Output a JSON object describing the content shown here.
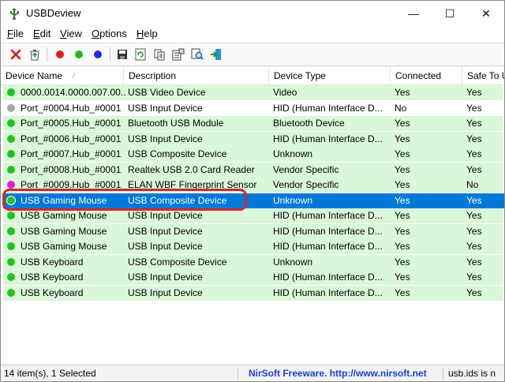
{
  "window": {
    "title": "USBDeview",
    "controls": {
      "minimize": "—",
      "maximize": "☐",
      "close": "✕"
    }
  },
  "menu": {
    "items": [
      {
        "first": "F",
        "rest": "ile"
      },
      {
        "first": "E",
        "rest": "dit"
      },
      {
        "first": "V",
        "rest": "iew"
      },
      {
        "first": "O",
        "rest": "ptions"
      },
      {
        "first": "H",
        "rest": "elp"
      }
    ]
  },
  "toolbar": {
    "icons": [
      "uninstall-icon",
      "recycle-icon",
      "red-dot-icon",
      "green-dot-icon",
      "blue-dot-icon",
      "save-icon",
      "refresh-icon",
      "copy-icon",
      "properties-icon",
      "find-icon",
      "exit-icon"
    ],
    "colors": {
      "red": "#e01c1c",
      "green": "#1bb81b",
      "blue": "#1c2fd6"
    }
  },
  "list": {
    "columns": [
      "Device Name",
      "Description",
      "Device Type",
      "Connected",
      "Safe To U"
    ],
    "sort_glyph": "⁄",
    "rows": [
      {
        "name": "0000.0014.0000.007.00...",
        "description": "USB Video Device",
        "type": "Video",
        "connected": "Yes",
        "safe": "Yes",
        "status": "green",
        "bg": "green"
      },
      {
        "name": "Port_#0004.Hub_#0001",
        "description": "USB Input Device",
        "type": "HID (Human Interface D...",
        "connected": "No",
        "safe": "Yes",
        "status": "gray",
        "bg": "white"
      },
      {
        "name": "Port_#0005.Hub_#0001",
        "description": "Bluetooth USB Module",
        "type": "Bluetooth Device",
        "connected": "Yes",
        "safe": "Yes",
        "status": "green",
        "bg": "green"
      },
      {
        "name": "Port_#0006.Hub_#0001",
        "description": "USB Input Device",
        "type": "HID (Human Interface D...",
        "connected": "Yes",
        "safe": "Yes",
        "status": "green",
        "bg": "green"
      },
      {
        "name": "Port_#0007.Hub_#0001",
        "description": "USB Composite Device",
        "type": "Unknown",
        "connected": "Yes",
        "safe": "Yes",
        "status": "green",
        "bg": "green"
      },
      {
        "name": "Port_#0008.Hub_#0001",
        "description": "Realtek USB 2.0 Card Reader",
        "type": "Vendor Specific",
        "connected": "Yes",
        "safe": "Yes",
        "status": "green",
        "bg": "green"
      },
      {
        "name": "Port_#0009.Hub_#0001",
        "description": "ELAN WBF Fingerprint Sensor",
        "type": "Vendor Specific",
        "connected": "Yes",
        "safe": "No",
        "status": "magenta",
        "bg": "green"
      },
      {
        "name": "USB Gaming Mouse",
        "description": "USB Composite Device",
        "type": "Unknown",
        "connected": "Yes",
        "safe": "Yes",
        "status": "green",
        "bg": "selected"
      },
      {
        "name": "USB Gaming Mouse",
        "description": "USB Input Device",
        "type": "HID (Human Interface D...",
        "connected": "Yes",
        "safe": "Yes",
        "status": "green",
        "bg": "green"
      },
      {
        "name": "USB Gaming Mouse",
        "description": "USB Input Device",
        "type": "HID (Human Interface D...",
        "connected": "Yes",
        "safe": "Yes",
        "status": "green",
        "bg": "green"
      },
      {
        "name": "USB Gaming Mouse",
        "description": "USB Input Device",
        "type": "HID (Human Interface D...",
        "connected": "Yes",
        "safe": "Yes",
        "status": "green",
        "bg": "green"
      },
      {
        "name": "USB Keyboard",
        "description": "USB Composite Device",
        "type": "Unknown",
        "connected": "Yes",
        "safe": "Yes",
        "status": "green",
        "bg": "green"
      },
      {
        "name": "USB Keyboard",
        "description": "USB Input Device",
        "type": "HID (Human Interface D...",
        "connected": "Yes",
        "safe": "Yes",
        "status": "green",
        "bg": "green"
      },
      {
        "name": "USB Keyboard",
        "description": "USB Input Device",
        "type": "HID (Human Interface D...",
        "connected": "Yes",
        "safe": "Yes",
        "status": "green",
        "bg": "green"
      }
    ],
    "colors": {
      "row_green": "#d9f7d9",
      "row_white": "#ffffff",
      "row_selected": "#0078d7",
      "dot_green": "#1fc41f",
      "dot_gray": "#a8a8a8",
      "dot_magenta": "#e01ce0",
      "highlight_ring": "#d6262e"
    }
  },
  "statusbar": {
    "count": "14 item(s), 1 Selected",
    "nirsoft": "NirSoft Freeware.  http://www.nirsoft.net",
    "usbids": "usb.ids is n"
  }
}
